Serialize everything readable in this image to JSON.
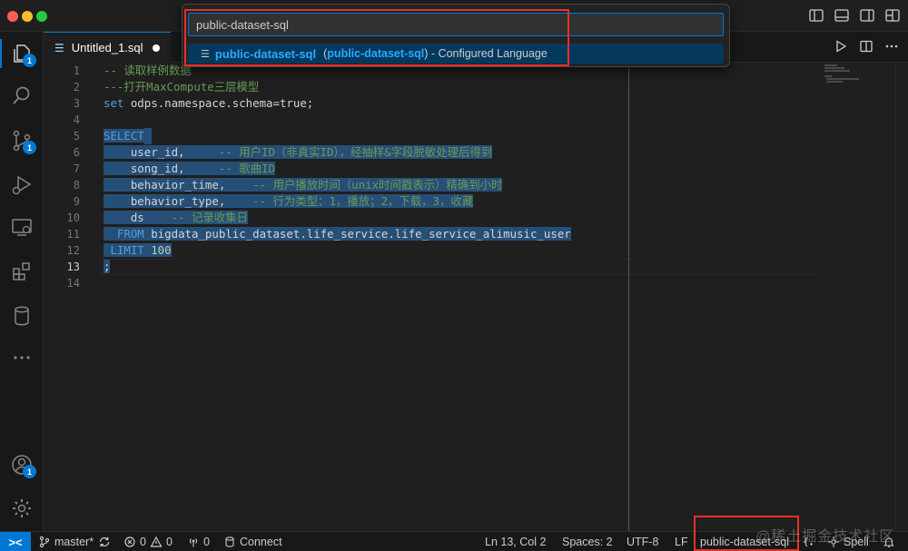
{
  "colors": {
    "accent": "#0078d4",
    "highlight_box": "#e8302a",
    "keyword": "#569cd6",
    "comment": "#6a9955",
    "number": "#b5cea8"
  },
  "quick_pick": {
    "input_value": "public-dataset-sql",
    "item": {
      "icon": "lines-icon",
      "label": "public-dataset-sql",
      "desc_open": "(",
      "desc_match": "public-dataset-sql",
      "desc_close": ") - Configured Language"
    }
  },
  "tab": {
    "filename": "Untitled_1.sql",
    "icon": "sql-file-icon"
  },
  "activity_bar": {
    "explorer_badge": "1",
    "scm_badge": "1",
    "accounts_badge": "1"
  },
  "editor": {
    "line_numbers": [
      "1",
      "2",
      "3",
      "4",
      "5",
      "6",
      "7",
      "8",
      "9",
      "10",
      "11",
      "12",
      "13",
      "14"
    ],
    "current_line": "13",
    "lines": {
      "l1": "-- 读取样例数据",
      "l2": "---打开MaxCompute三层模型",
      "l3": "set odps.namespace.schema=true;",
      "l5": "SELECT",
      "l6a": "    user_id,",
      "l6b": "     -- 用户ID（非真实ID），经抽样&字段脱敏处理后得到",
      "l7a": "    song_id,",
      "l7b": "     -- 歌曲ID",
      "l8a": "    behavior_time,",
      "l8b": "    -- 用户播放时间（unix时间戳表示）精确到小时",
      "l9a": "    behavior_type,",
      "l9b": "    -- 行为类型：1，播放；2，下载，3，收藏",
      "l10a": "    ds",
      "l10b": "    -- 记录收集日",
      "l11a": "  FROM",
      "l11b": " bigdata_public_dataset.life_service.life_service_alimusic_user",
      "l12a": " LIMIT",
      "l12b": " 100",
      "l13": ";"
    }
  },
  "status_bar": {
    "branch": "master*",
    "errors": "0",
    "warnings": "0",
    "ports": "0",
    "connect": "Connect",
    "cursor": "Ln 13, Col 2",
    "spaces": "Spaces: 2",
    "encoding": "UTF-8",
    "eol": "LF",
    "language": "public-dataset-sql",
    "spell": "Spell"
  },
  "watermark": "@稀土掘金技术社区"
}
